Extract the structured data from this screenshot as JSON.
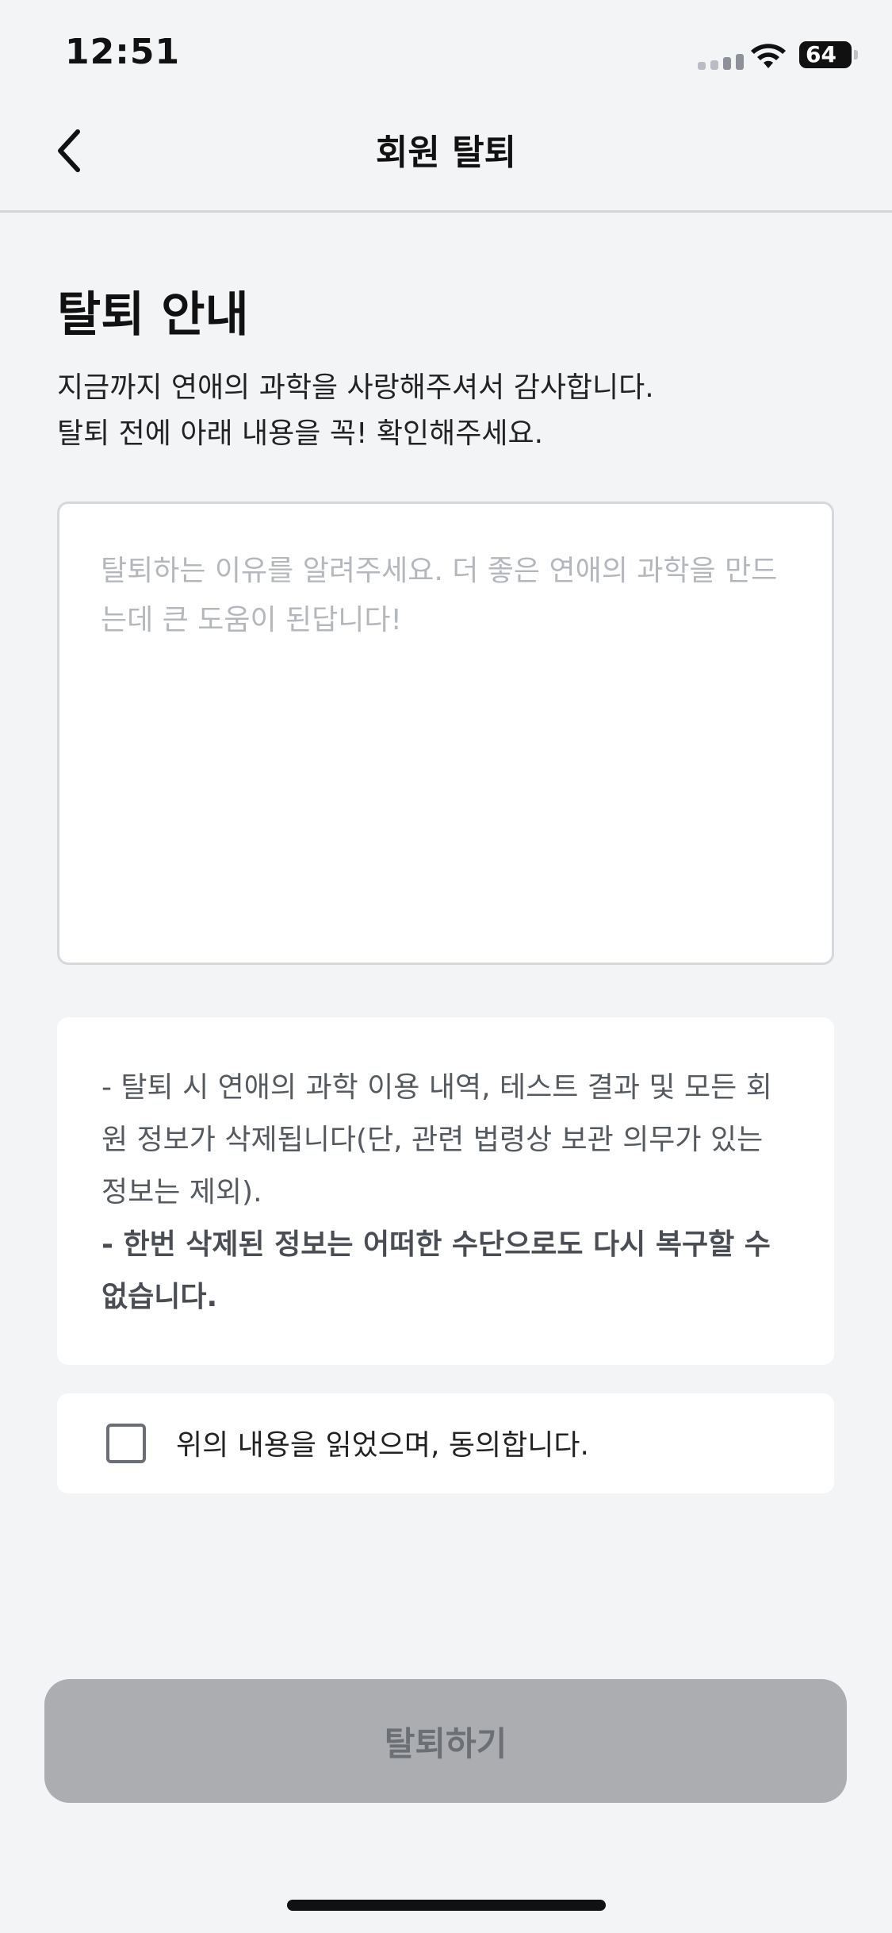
{
  "status_bar": {
    "time": "12:51",
    "battery": "64"
  },
  "nav": {
    "title": "회원 탈퇴"
  },
  "content": {
    "section_title": "탈퇴 안내",
    "intro_line1": "지금까지 연애의 과학을 사랑해주셔서 감사합니다.",
    "intro_line2": "탈퇴 전에 아래 내용을 꼭! 확인해주세요.",
    "reason_placeholder": "탈퇴하는 이유를 알려주세요. 더 좋은 연애의 과학을 만드는데 큰 도움이 된답니다!",
    "reason_value": "",
    "notice_line1": "- 탈퇴 시 연애의 과학 이용 내역, 테스트 결과 및 모든 회원 정보가 삭제됩니다(단, 관련 법령상 보관 의무가 있는 정보는 제외).",
    "notice_line2": "- 한번 삭제된 정보는 어떠한 수단으로도 다시 복구할 수 없습니다.",
    "agree_label": "위의 내용을 읽었으며, 동의합니다.",
    "agree_checked": false
  },
  "footer": {
    "withdraw_button": "탈퇴하기"
  },
  "colors": {
    "background": "#f3f4f6",
    "card": "#ffffff",
    "button_disabled": "#abadb1",
    "button_text_disabled": "#6c6f74"
  },
  "icons": {
    "back": "chevron-left-icon",
    "wifi": "wifi-icon",
    "signal": "cellular-signal-icon",
    "battery": "battery-icon"
  }
}
